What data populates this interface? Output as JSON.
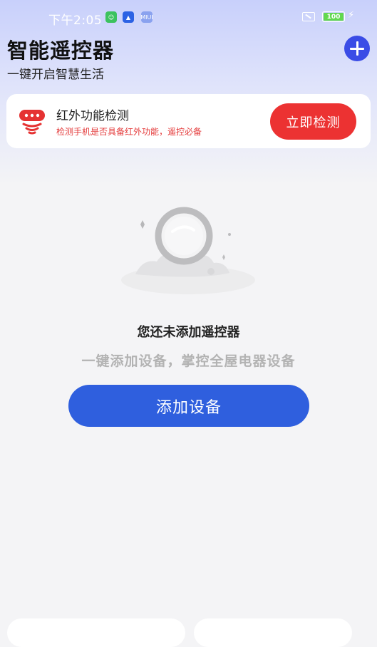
{
  "status_bar": {
    "time": "下午2:05",
    "battery": "100",
    "app_icons": [
      "wechat-icon",
      "alipay-icon",
      "miui-icon"
    ],
    "app_badge_text": "MIUI"
  },
  "header": {
    "title": "智能遥控器",
    "subtitle": "一键开启智慧生活"
  },
  "ir_check": {
    "title": "红外功能检测",
    "description": "检测手机是否具备红外功能，遥控必备",
    "button_label": "立即检测"
  },
  "empty_state": {
    "title": "您还未添加遥控器",
    "description": "一键添加设备，掌控全屋电器设备",
    "button_label": "添加设备"
  },
  "colors": {
    "primary_blue": "#2f5fde",
    "fab_blue": "#3a4ce6",
    "alert_red": "#ec3232"
  }
}
